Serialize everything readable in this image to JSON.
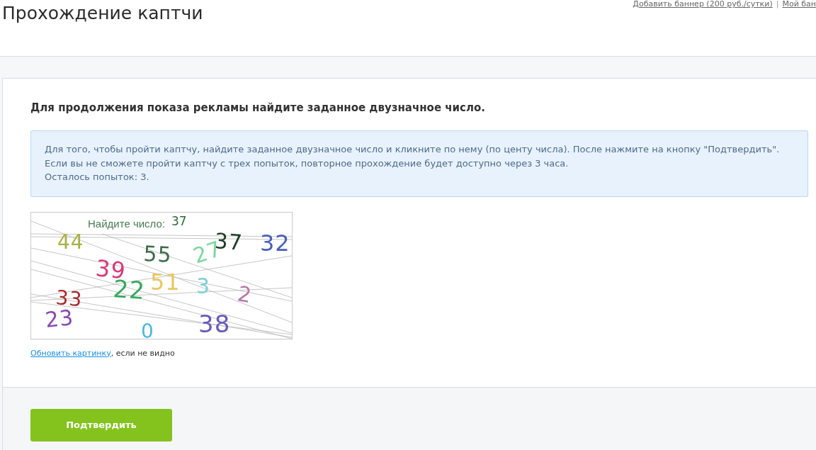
{
  "header": {
    "title": "Прохождение каптчи",
    "links": [
      "Добавить баннер (200 руб./сутки)",
      "Мой бан"
    ],
    "separator": "|"
  },
  "card": {
    "heading": "Для продолжения показа рекламы найдите заданное двузначное число.",
    "info": {
      "lines": [
        "Для того, чтобы пройти каптчу, найдите заданное двузначное число и кликните по нему (по центу числа). После нажмите на кнопку \"Подтвердить\".",
        "Если вы не сможете пройти каптчу с трех попыток, повторное прохождение будет доступно через 3 часа.",
        "Осталось попыток: 3."
      ]
    },
    "captcha": {
      "prompt": "Найдите число:",
      "target": "37",
      "numbers": [
        {
          "text": "44",
          "color": "#a9b04a"
        },
        {
          "text": "37",
          "color": "#1f3d24"
        },
        {
          "text": "32",
          "color": "#4a5fb8"
        },
        {
          "text": "55",
          "color": "#3e6b4a"
        },
        {
          "text": "27",
          "color": "#7ed6a0"
        },
        {
          "text": "39",
          "color": "#d83a78"
        },
        {
          "text": "22",
          "color": "#3aa860"
        },
        {
          "text": "51",
          "color": "#e8c860"
        },
        {
          "text": "3",
          "color": "#7ecfd8"
        },
        {
          "text": "2",
          "color": "#b87aa8"
        },
        {
          "text": "33",
          "color": "#a82a30"
        },
        {
          "text": "23",
          "color": "#8a4ab0"
        },
        {
          "text": "0",
          "color": "#4ab8e0"
        },
        {
          "text": "38",
          "color": "#6a5ab8"
        }
      ]
    },
    "refresh": {
      "link": "Обновить картинку",
      "text": ", если не видно"
    },
    "submit_button": "Подтвердить"
  }
}
